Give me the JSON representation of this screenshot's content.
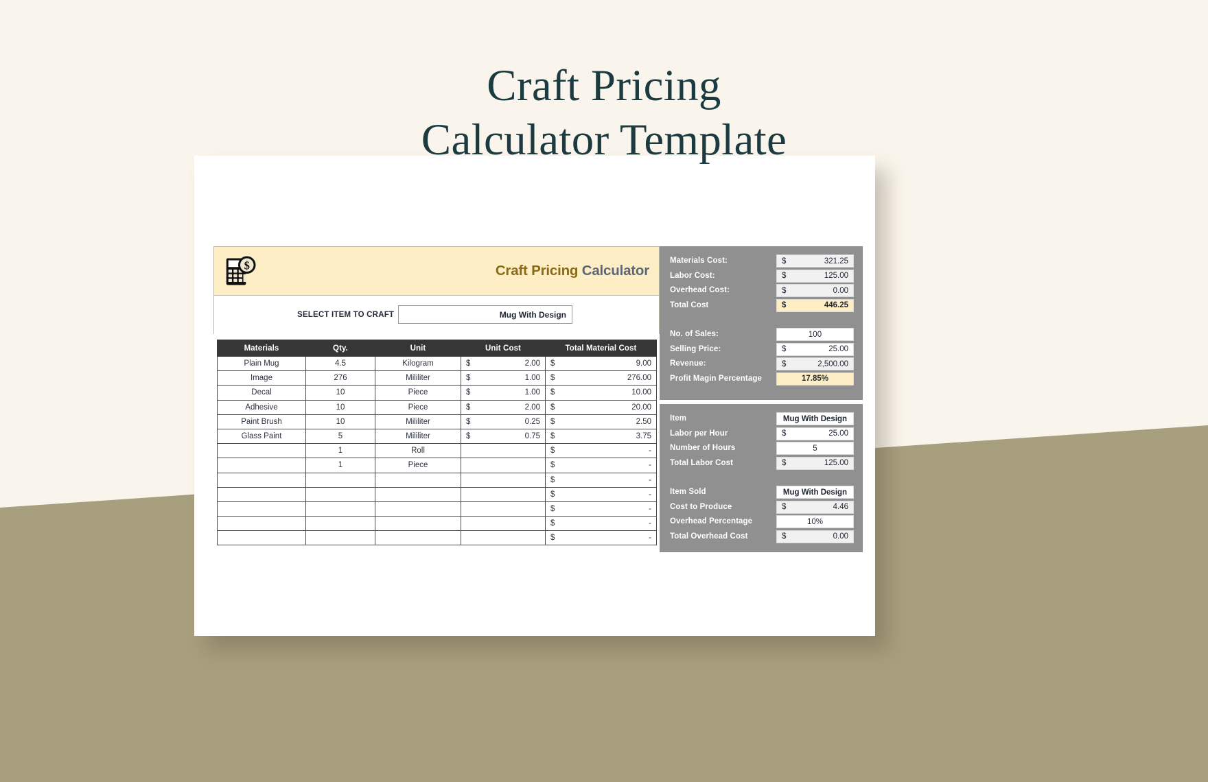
{
  "page": {
    "title_line1": "Craft Pricing",
    "title_line2": "Calculator Template",
    "bg_color": "#faf5ec",
    "band_color": "#a89f7e",
    "title_color": "#1b3b40"
  },
  "banner": {
    "icon": "calculator-dollar-icon",
    "title_part1": "Craft Pricing",
    "title_part2": "Calculator",
    "part1_color": "#8a6a16",
    "part2_color": "#5d6677",
    "bg_color": "#fdeec6"
  },
  "select_item": {
    "label": "SELECT ITEM TO CRAFT",
    "separator": ":",
    "value": "Mug With Design",
    "placeholder": "Mug With Design"
  },
  "materials_table": {
    "headers": [
      "Materials",
      "Qty.",
      "Unit",
      "Unit Cost",
      "Total Material Cost"
    ],
    "currency": "$",
    "rows": [
      {
        "material": "Plain Mug",
        "qty": "4.5",
        "unit": "Kilogram",
        "unit_cost": "2.00",
        "total": "9.00"
      },
      {
        "material": "Image",
        "qty": "276",
        "unit": "Mililiter",
        "unit_cost": "1.00",
        "total": "276.00"
      },
      {
        "material": "Decal",
        "qty": "10",
        "unit": "Piece",
        "unit_cost": "1.00",
        "total": "10.00"
      },
      {
        "material": "Adhesive",
        "qty": "10",
        "unit": "Piece",
        "unit_cost": "2.00",
        "total": "20.00"
      },
      {
        "material": "Paint Brush",
        "qty": "10",
        "unit": "Mililiter",
        "unit_cost": "0.25",
        "total": "2.50"
      },
      {
        "material": "Glass Paint",
        "qty": "5",
        "unit": "Mililiter",
        "unit_cost": "0.75",
        "total": "3.75"
      },
      {
        "material": "",
        "qty": "1",
        "unit": "Roll",
        "unit_cost": "",
        "total": "-"
      },
      {
        "material": "",
        "qty": "1",
        "unit": "Piece",
        "unit_cost": "",
        "total": "-"
      },
      {
        "material": "",
        "qty": "",
        "unit": "",
        "unit_cost": "",
        "total": "-"
      },
      {
        "material": "",
        "qty": "",
        "unit": "",
        "unit_cost": "",
        "total": "-"
      },
      {
        "material": "",
        "qty": "",
        "unit": "",
        "unit_cost": "",
        "total": "-"
      },
      {
        "material": "",
        "qty": "",
        "unit": "",
        "unit_cost": "",
        "total": "-"
      },
      {
        "material": "",
        "qty": "",
        "unit": "",
        "unit_cost": "",
        "total": "-"
      }
    ]
  },
  "summary_panel": {
    "cost_group": [
      {
        "label": "Materials Cost:",
        "currency": "$",
        "value": "321.25",
        "style": "grey"
      },
      {
        "label": "Labor Cost:",
        "currency": "$",
        "value": "125.00",
        "style": "grey"
      },
      {
        "label": "Overhead Cost:",
        "currency": "$",
        "value": "0.00",
        "style": "grey"
      },
      {
        "label": "Total Cost",
        "currency": "$",
        "value": "446.25",
        "style": "highlight"
      }
    ],
    "sales_group": [
      {
        "label": "No. of Sales:",
        "currency": "",
        "value": "100",
        "style": "white-center"
      },
      {
        "label": "Selling Price:",
        "currency": "$",
        "value": "25.00",
        "style": "white"
      },
      {
        "label": "Revenue:",
        "currency": "$",
        "value": "2,500.00",
        "style": "grey"
      },
      {
        "label": "Profit Magin Percentage",
        "currency": "",
        "value": "17.85%",
        "style": "highlight-center"
      }
    ]
  },
  "labor_panel": {
    "labor_group": [
      {
        "label": "Item",
        "currency": "",
        "value": "Mug With Design",
        "style": "white-center-bold"
      },
      {
        "label": "Labor per Hour",
        "currency": "$",
        "value": "25.00",
        "style": "white"
      },
      {
        "label": "Number of Hours",
        "currency": "",
        "value": "5",
        "style": "white-center"
      },
      {
        "label": "Total Labor Cost",
        "currency": "$",
        "value": "125.00",
        "style": "grey"
      }
    ],
    "overhead_group": [
      {
        "label": "Item Sold",
        "currency": "",
        "value": "Mug With Design",
        "style": "white-center-bold"
      },
      {
        "label": "Cost to Produce",
        "currency": "$",
        "value": "4.46",
        "style": "grey"
      },
      {
        "label": "Overhead Percentage",
        "currency": "",
        "value": "10%",
        "style": "white-center"
      },
      {
        "label": "Total Overhead Cost",
        "currency": "$",
        "value": "0.00",
        "style": "grey"
      }
    ]
  }
}
